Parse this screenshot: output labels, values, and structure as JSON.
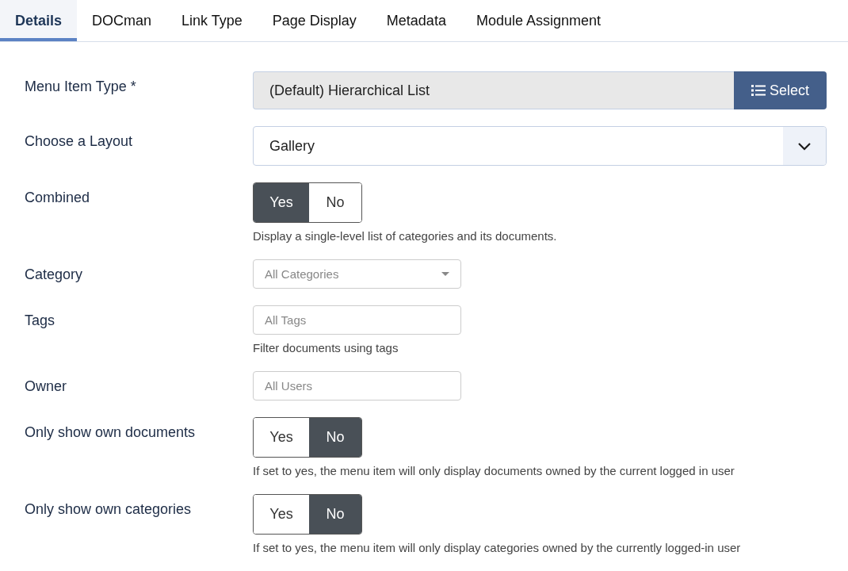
{
  "tabs": [
    {
      "label": "Details",
      "selected": true
    },
    {
      "label": "DOCman",
      "selected": false
    },
    {
      "label": "Link Type",
      "selected": false
    },
    {
      "label": "Page Display",
      "selected": false
    },
    {
      "label": "Metadata",
      "selected": false
    },
    {
      "label": "Module Assignment",
      "selected": false
    }
  ],
  "fields": [
    {
      "kind": "type-select",
      "label": "Menu Item Type *",
      "value": "(Default) Hierarchical List",
      "button": "Select"
    },
    {
      "kind": "layout-select",
      "label": "Choose a Layout",
      "value": "Gallery"
    },
    {
      "kind": "toggle",
      "label": "Combined",
      "options": [
        {
          "label": "Yes",
          "selected": true
        },
        {
          "label": "No",
          "selected": false
        }
      ],
      "help": "Display a single-level list of categories and its documents."
    },
    {
      "kind": "dropdown",
      "label": "Category",
      "placeholder": "All Categories"
    },
    {
      "kind": "text",
      "label": "Tags",
      "placeholder": "All Tags",
      "help": "Filter documents using tags"
    },
    {
      "kind": "text",
      "label": "Owner",
      "placeholder": "All Users"
    },
    {
      "kind": "toggle",
      "label": "Only show own documents",
      "options": [
        {
          "label": "Yes",
          "selected": false
        },
        {
          "label": "No",
          "selected": true
        }
      ],
      "help": "If set to yes, the menu item will only display documents owned by the current logged in user"
    },
    {
      "kind": "toggle",
      "label": "Only show own categories",
      "options": [
        {
          "label": "Yes",
          "selected": false
        },
        {
          "label": "No",
          "selected": true
        }
      ],
      "help": "If set to yes, the menu item will only display categories owned by the currently logged-in user"
    }
  ]
}
